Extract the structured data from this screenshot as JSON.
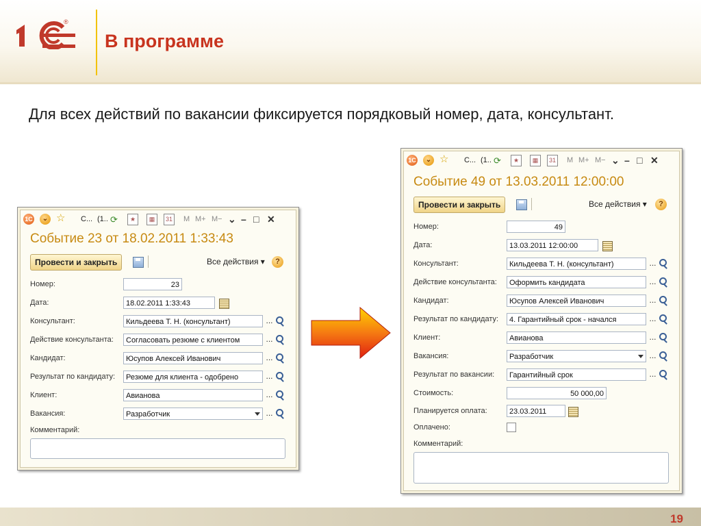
{
  "slide": {
    "title": "В программе",
    "text": "Для всех действий по вакансии фиксируется порядковый номер, дата, консультант.",
    "page_number": "19"
  },
  "colors": {
    "title_red": "#c8341f",
    "window_title": "#c78a12",
    "arrow_start": "#ffd200",
    "arrow_end": "#e02010"
  },
  "icons": [
    "1c-logo",
    "1c-menu-icon",
    "dropdown-menu-icon",
    "favorites-star-icon",
    "refresh-icon",
    "bookmark-icon",
    "calculator-icon",
    "calendar-icon",
    "minimize-icon",
    "maximize-icon",
    "close-icon",
    "save-icon",
    "help-icon",
    "select-dots-icon",
    "search-icon",
    "arrow-right-icon"
  ],
  "toolbar": {
    "tab1": "С...",
    "tab2": "(1..",
    "calendar_text": "31",
    "memory_m": "M",
    "memory_mplus": "M+",
    "memory_mminus": "M−",
    "collapse": "⌄",
    "minimize": "–",
    "maximize": "□",
    "close": "✕"
  },
  "common": {
    "post_close": "Провести и закрыть",
    "all_actions": "Все действия ▾",
    "help": "?",
    "dots": "...",
    "cal_glyph": ""
  },
  "labels": {
    "number": "Номер:",
    "date": "Дата:",
    "consultant": "Консультант:",
    "consultant_action": "Действие консультанта:",
    "candidate": "Кандидат:",
    "candidate_result": "Результат по кандидату:",
    "client": "Клиент:",
    "vacancy": "Вакансия:",
    "vacancy_result": "Результат по вакансии:",
    "cost": "Стоимость:",
    "planned_payment": "Планируется оплата:",
    "paid": "Оплачено:",
    "comment": "Комментарий:"
  },
  "window1": {
    "title": "Событие 23 от 18.02.2011 1:33:43",
    "number": "23",
    "date": "18.02.2011  1:33:43",
    "consultant": "Кильдеева Т. Н. (консультант)",
    "consultant_action": "Согласовать резюме с клиентом",
    "candidate": "Юсупов Алексей Иванович",
    "candidate_result": "Резюме для клиента - одобрено",
    "client": "Авианова",
    "vacancy": "Разработчик",
    "comment": ""
  },
  "window2": {
    "title": "Событие 49 от 13.03.2011 12:00:00",
    "number": "49",
    "date": "13.03.2011 12:00:00",
    "consultant": "Кильдеева Т. Н. (консультант)",
    "consultant_action": "Оформить кандидата",
    "candidate": "Юсупов Алексей Иванович",
    "candidate_result": "4. Гарантийный срок - начался",
    "client": "Авианова",
    "vacancy": "Разработчик",
    "vacancy_result": "Гарантийный срок",
    "cost": "50 000,00",
    "planned_payment": "23.03.2011",
    "paid": false,
    "comment": ""
  }
}
